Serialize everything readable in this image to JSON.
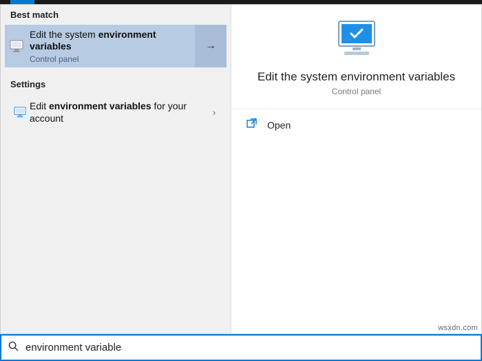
{
  "topbar": {},
  "left": {
    "best_match_header": "Best match",
    "best_match": {
      "title_pre": "Edit the system ",
      "title_bold": "environment variables",
      "title_post": "",
      "subtitle": "Control panel"
    },
    "settings_header": "Settings",
    "settings_item": {
      "text_pre": "Edit ",
      "text_bold": "environment variables",
      "text_post": " for your account"
    }
  },
  "right": {
    "hero_title": "Edit the system environment variables",
    "hero_sub": "Control panel",
    "open_label": "Open"
  },
  "search": {
    "value": "environment variable",
    "placeholder": ""
  },
  "watermark": "wsxdn.com"
}
